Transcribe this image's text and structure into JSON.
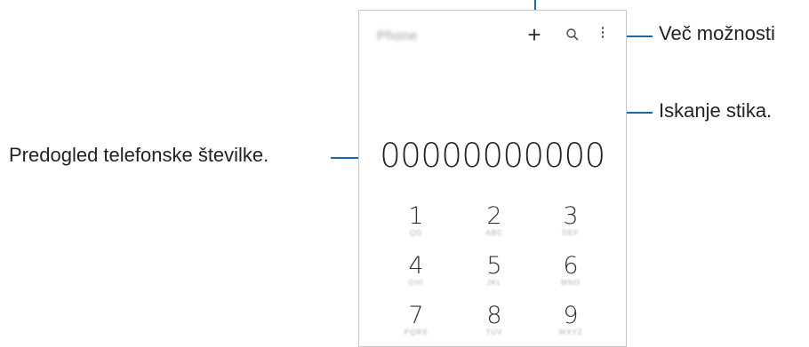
{
  "app": {
    "title": "Phone",
    "number_preview": "00000000000"
  },
  "toolbar": {
    "add_icon": "plus-icon",
    "search_icon": "search-icon",
    "more_icon": "kebab-menu-icon"
  },
  "keypad": [
    {
      "digit": "1",
      "letters": "QD"
    },
    {
      "digit": "2",
      "letters": "ABC"
    },
    {
      "digit": "3",
      "letters": "DEF"
    },
    {
      "digit": "4",
      "letters": "GHI"
    },
    {
      "digit": "5",
      "letters": "JKL"
    },
    {
      "digit": "6",
      "letters": "MNO"
    },
    {
      "digit": "7",
      "letters": "PQRS"
    },
    {
      "digit": "8",
      "letters": "TUV"
    },
    {
      "digit": "9",
      "letters": "WXYZ"
    }
  ],
  "callouts": {
    "more_options": "Več možnosti",
    "search_contacts": "Iskanje stika.",
    "number_preview": "Predogled telefonske številke."
  },
  "colors": {
    "callout_line": "#1a66b3"
  }
}
